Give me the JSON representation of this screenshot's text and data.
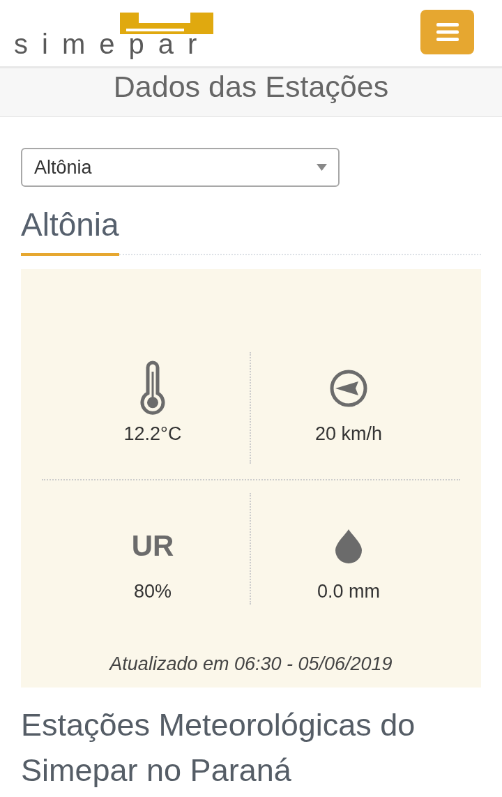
{
  "header": {
    "logo_text": "simepar"
  },
  "page_title": "Dados das Estações",
  "station_select": {
    "value": "Altônia"
  },
  "station_heading": "Altônia",
  "readings": [
    {
      "kind": "temperature",
      "value": "12.2°C"
    },
    {
      "kind": "wind",
      "value": "20 km/h"
    },
    {
      "kind": "humidity",
      "label": "UR",
      "value": "80%"
    },
    {
      "kind": "rain",
      "value": "0.0 mm"
    }
  ],
  "updated": "Atualizado em 06:30 - 05/06/2019",
  "section_title": "Estações Meteorológicas do Simepar no Paraná"
}
